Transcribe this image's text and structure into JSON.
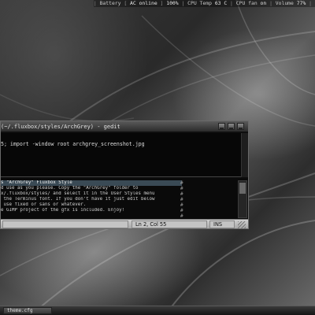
{
  "topbar": {
    "battery_label": "Battery",
    "battery_value": "AC online",
    "battery_percent": "100%",
    "cpu_temp_label": "CPU Temp",
    "cpu_temp_value": "63 C",
    "cpu_fan_label": "CPU fan",
    "cpu_fan_value": "on",
    "volume_label": "Volume",
    "volume_value": "77%"
  },
  "window": {
    "title": "(~/.fluxbox/styles/ArchGrey) - gedit",
    "command": "5; import -window root archgrey_screenshot.jpg",
    "editor_lines": [
      "s \"ArchGrey\" Fluxbox Style",
      "d use as you please. Copy the \"ArchGrey\" folder to",
      "x/.fluxbox/styles/ and select it in the User Styles menu",
      " the Terminus font. If you don't have it just edit below",
      " use fixed or sans or whatever.",
      "e GIMP project of the gfx is included. Enjoy!",
      ""
    ],
    "ruler_marks": [
      "#",
      "#",
      "#",
      "#",
      "#",
      "#",
      "#"
    ],
    "status": {
      "position": "Ln 2, Col 55",
      "mode": "INS"
    }
  },
  "taskbar": {
    "task_label": "theme.cfg"
  }
}
